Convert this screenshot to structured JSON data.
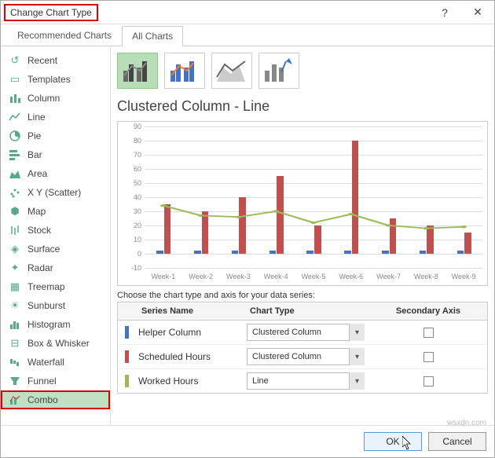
{
  "window": {
    "title": "Change Chart Type"
  },
  "tabs": {
    "recommended": "Recommended Charts",
    "all": "All Charts"
  },
  "sidebar": {
    "items": [
      {
        "label": "Recent"
      },
      {
        "label": "Templates"
      },
      {
        "label": "Column"
      },
      {
        "label": "Line"
      },
      {
        "label": "Pie"
      },
      {
        "label": "Bar"
      },
      {
        "label": "Area"
      },
      {
        "label": "X Y (Scatter)"
      },
      {
        "label": "Map"
      },
      {
        "label": "Stock"
      },
      {
        "label": "Surface"
      },
      {
        "label": "Radar"
      },
      {
        "label": "Treemap"
      },
      {
        "label": "Sunburst"
      },
      {
        "label": "Histogram"
      },
      {
        "label": "Box & Whisker"
      },
      {
        "label": "Waterfall"
      },
      {
        "label": "Funnel"
      },
      {
        "label": "Combo"
      }
    ]
  },
  "chart": {
    "subtype_title": "Clustered Column - Line"
  },
  "chart_data": {
    "type": "bar",
    "categories": [
      "Week-1",
      "Week-2",
      "Week-3",
      "Week-4",
      "Week-5",
      "Week-6",
      "Week-7",
      "Week-8",
      "Week-9"
    ],
    "series": [
      {
        "name": "Helper Column",
        "type": "bar",
        "values": [
          2,
          2,
          2,
          2,
          2,
          2,
          2,
          2,
          2
        ],
        "color": "#4472c4"
      },
      {
        "name": "Scheduled Hours",
        "type": "bar",
        "values": [
          35,
          30,
          40,
          55,
          20,
          80,
          25,
          20,
          15
        ],
        "color": "#c0504d"
      },
      {
        "name": "Worked Hours",
        "type": "line",
        "values": [
          34,
          27,
          26,
          30,
          22,
          28,
          20,
          18,
          19
        ],
        "color": "#9bbb59"
      }
    ],
    "ylim": [
      -10,
      90
    ],
    "yticks": [
      -10,
      0,
      10,
      20,
      30,
      40,
      50,
      60,
      70,
      80,
      90
    ],
    "xlabel": "",
    "ylabel": "",
    "title": ""
  },
  "series_section": {
    "instruction": "Choose the chart type and axis for your data series:",
    "headers": {
      "name": "Series Name",
      "type": "Chart Type",
      "secondary": "Secondary Axis"
    },
    "rows": [
      {
        "name": "Helper Column",
        "type": "Clustered Column",
        "swatch": "#4472c4"
      },
      {
        "name": "Scheduled Hours",
        "type": "Clustered Column",
        "swatch": "#c0504d"
      },
      {
        "name": "Worked Hours",
        "type": "Line",
        "swatch": "#9bbb59"
      }
    ]
  },
  "footer": {
    "ok": "OK",
    "cancel": "Cancel"
  },
  "watermark": "wsxdn.com"
}
